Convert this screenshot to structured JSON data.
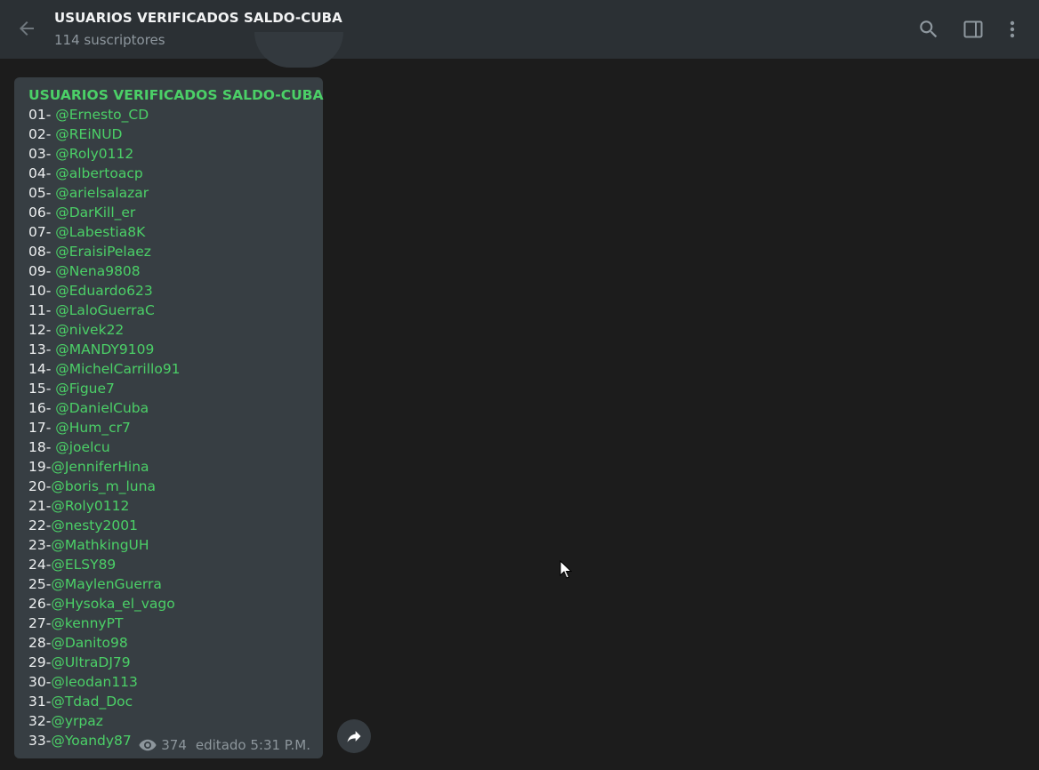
{
  "header": {
    "title": "USUARIOS VERIFICADOS SALDO-CUBA",
    "subtitle": "114 suscriptores",
    "icons": [
      "back-arrow-icon",
      "search-icon",
      "sidebar-toggle-icon",
      "more-vert-icon"
    ]
  },
  "message": {
    "title": "USUARIOS VERIFICADOS SALDO-CUBA",
    "entries": [
      {
        "num": "01- ",
        "handle": "@Ernesto_CD"
      },
      {
        "num": "02- ",
        "handle": "@REiNUD"
      },
      {
        "num": "03- ",
        "handle": "@Roly0112"
      },
      {
        "num": "04- ",
        "handle": "@albertoacp"
      },
      {
        "num": "05- ",
        "handle": "@arielsalazar"
      },
      {
        "num": "06- ",
        "handle": "@DarKill_er"
      },
      {
        "num": "07- ",
        "handle": "@Labestia8K"
      },
      {
        "num": "08- ",
        "handle": "@EraisiPelaez"
      },
      {
        "num": "09- ",
        "handle": "@Nena9808"
      },
      {
        "num": "10- ",
        "handle": "@Eduardo623"
      },
      {
        "num": "11- ",
        "handle": "@LaloGuerraC"
      },
      {
        "num": "12- ",
        "handle": "@nivek22"
      },
      {
        "num": "13- ",
        "handle": "@MANDY9109"
      },
      {
        "num": "14- ",
        "handle": "@MichelCarrillo91"
      },
      {
        "num": "15- ",
        "handle": "@Figue7"
      },
      {
        "num": "16- ",
        "handle": "@DanielCuba"
      },
      {
        "num": "17- ",
        "handle": "@Hum_cr7"
      },
      {
        "num": "18- ",
        "handle": "@joelcu"
      },
      {
        "num": "19-",
        "handle": "@JenniferHina"
      },
      {
        "num": "20-",
        "handle": "@boris_m_luna"
      },
      {
        "num": "21-",
        "handle": "@Roly0112"
      },
      {
        "num": "22-",
        "handle": "@nesty2001"
      },
      {
        "num": "23-",
        "handle": "@MathkingUH"
      },
      {
        "num": "24-",
        "handle": "@ELSY89"
      },
      {
        "num": "25-",
        "handle": "@MaylenGuerra"
      },
      {
        "num": "26-",
        "handle": "@Hysoka_el_vago"
      },
      {
        "num": "27-",
        "handle": "@kennyPT"
      },
      {
        "num": "28-",
        "handle": "@Danito98"
      },
      {
        "num": "29-",
        "handle": "@UltraDJ79"
      },
      {
        "num": "30-",
        "handle": "@leodan113"
      },
      {
        "num": "31-",
        "handle": "@Tdad_Doc"
      },
      {
        "num": "32-",
        "handle": "@yrpaz"
      },
      {
        "num": "33-",
        "handle": "@Yoandy87"
      }
    ],
    "views": "374",
    "edited_time": "editado 5:31 P.M."
  },
  "colors": {
    "header_bg": "#2b3034",
    "chat_bg": "#1c1c1c",
    "bubble_bg": "#373e43",
    "link_green": "#4bd067",
    "text": "#eef0f1",
    "muted": "#8d969c"
  }
}
